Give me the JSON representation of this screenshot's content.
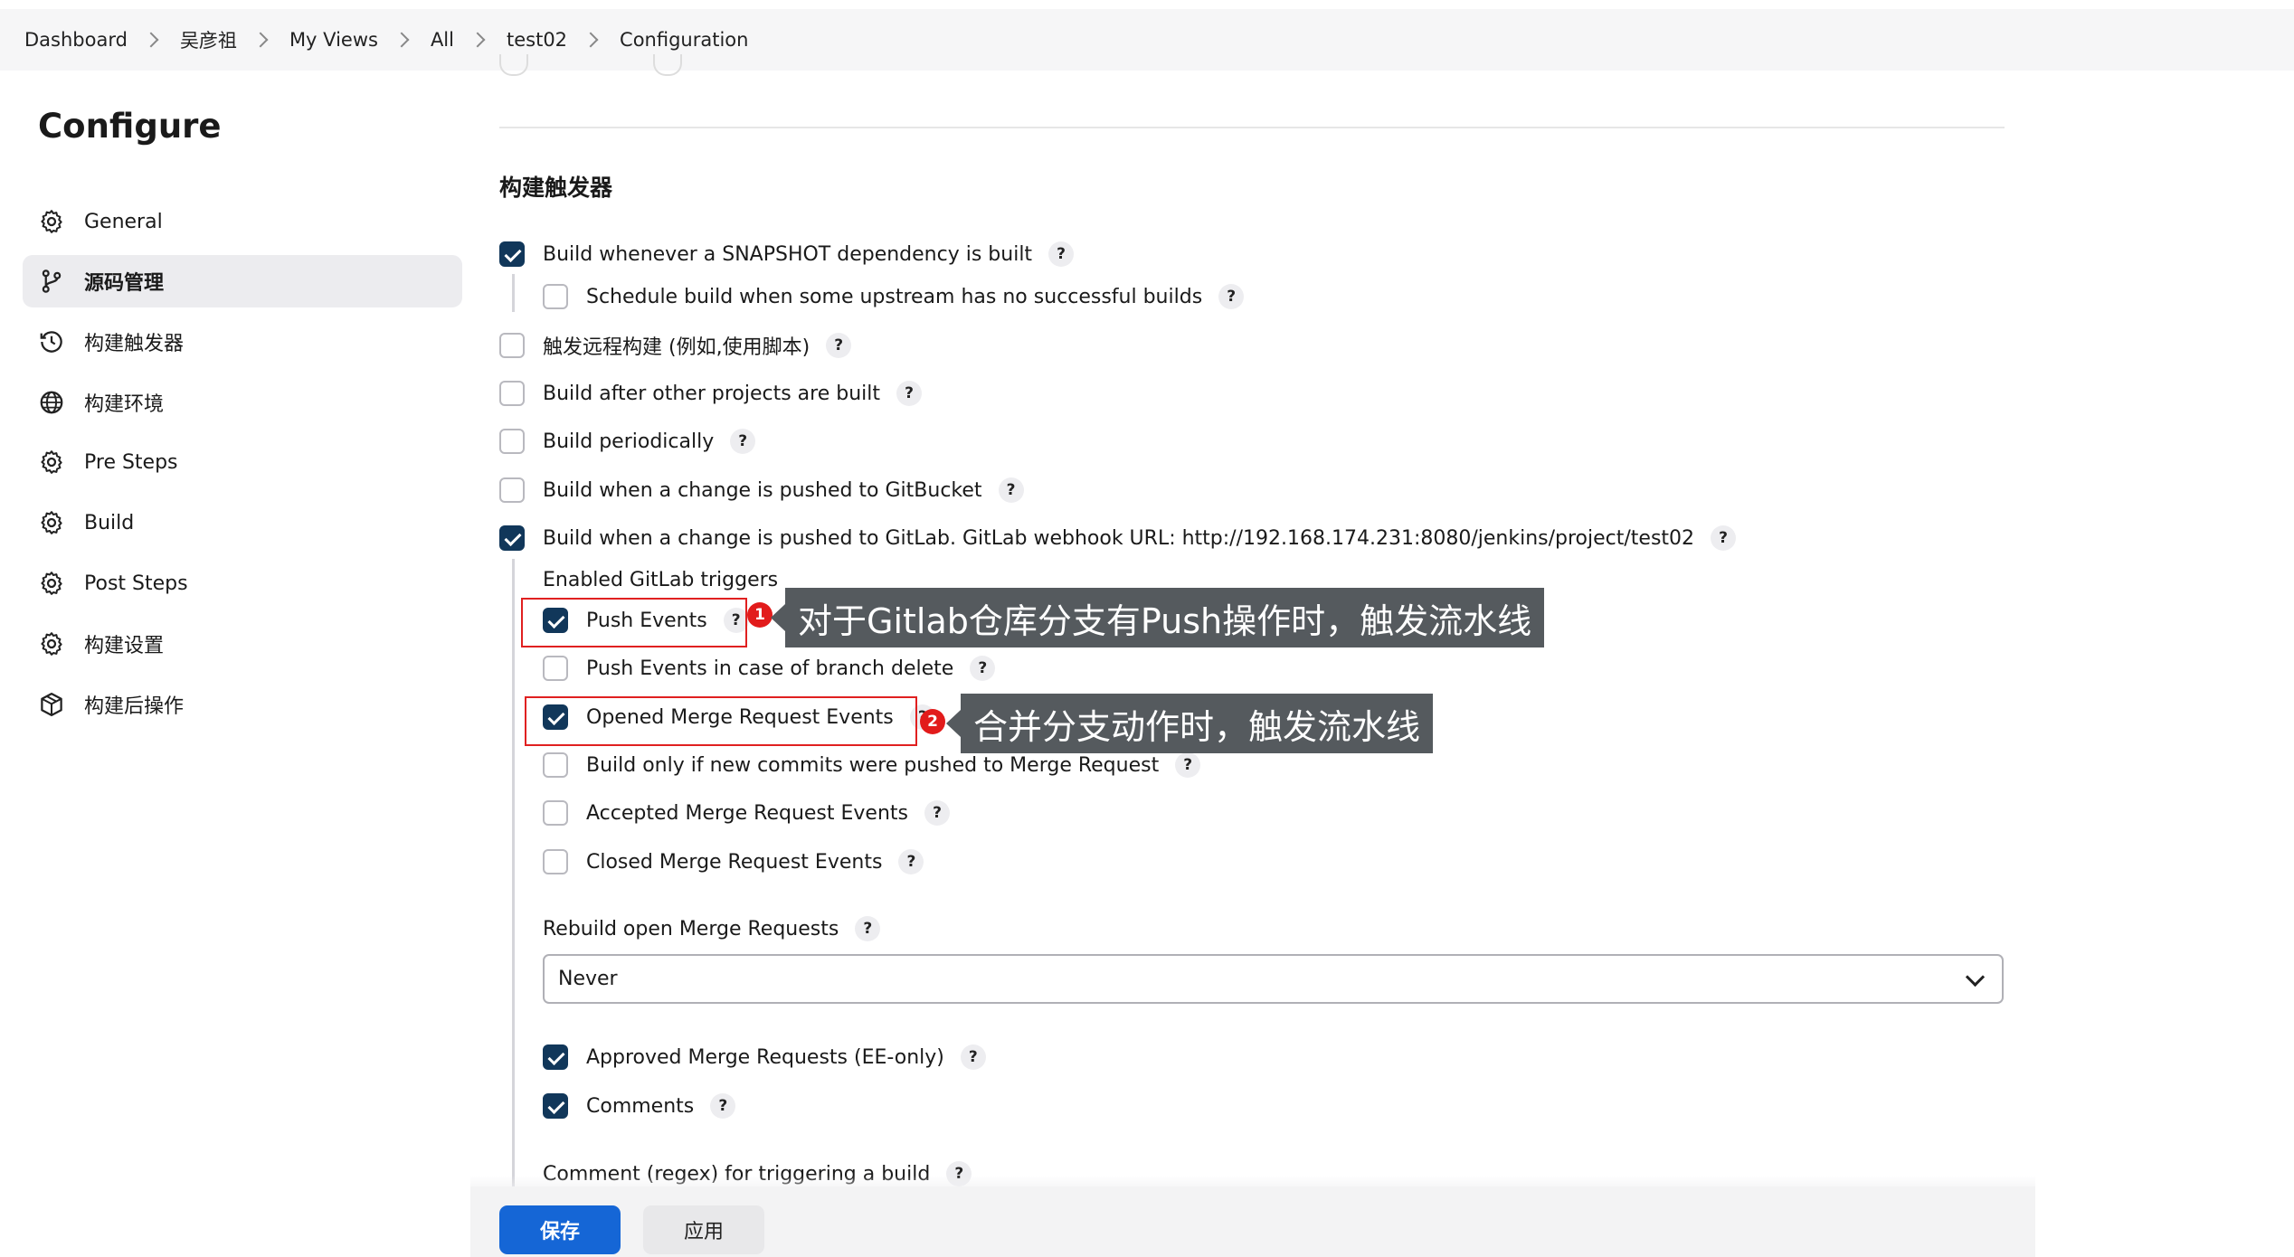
{
  "breadcrumb": [
    "Dashboard",
    "吴彦祖",
    "My Views",
    "All",
    "test02",
    "Configuration"
  ],
  "page_title": "Configure",
  "sidebar": {
    "items": [
      {
        "label": "General",
        "icon": "gear-icon"
      },
      {
        "label": "源码管理",
        "icon": "branch-icon",
        "active": true
      },
      {
        "label": "构建触发器",
        "icon": "clock-icon"
      },
      {
        "label": "构建环境",
        "icon": "globe-icon"
      },
      {
        "label": "Pre Steps",
        "icon": "gear-icon"
      },
      {
        "label": "Build",
        "icon": "gear-icon"
      },
      {
        "label": "Post Steps",
        "icon": "gear-icon"
      },
      {
        "label": "构建设置",
        "icon": "gear-icon"
      },
      {
        "label": "构建后操作",
        "icon": "package-icon"
      }
    ]
  },
  "section": {
    "title": "构建触发器",
    "options": [
      {
        "label": "Build whenever a SNAPSHOT dependency is built",
        "checked": true
      },
      {
        "label": "Schedule build when some upstream has no successful builds",
        "checked": false
      },
      {
        "label": "触发远程构建 (例如,使用脚本)",
        "checked": false
      },
      {
        "label": "Build after other projects are built",
        "checked": false
      },
      {
        "label": "Build periodically",
        "checked": false
      },
      {
        "label": "Build when a change is pushed to GitBucket",
        "checked": false
      },
      {
        "label": "Build when a change is pushed to GitLab. GitLab webhook URL: http://192.168.174.231:8080/jenkins/project/test02",
        "checked": true
      }
    ]
  },
  "gitlab": {
    "enabled_triggers_label": "Enabled GitLab triggers",
    "triggers": [
      {
        "label": "Push Events",
        "checked": true
      },
      {
        "label": "Push Events in case of branch delete",
        "checked": false
      },
      {
        "label": "Opened Merge Request Events",
        "checked": true
      },
      {
        "label": "Build only if new commits were pushed to Merge Request",
        "checked": false
      },
      {
        "label": "Accepted Merge Request Events",
        "checked": false
      },
      {
        "label": "Closed Merge Request Events",
        "checked": false
      }
    ],
    "rebuild_label": "Rebuild open Merge Requests",
    "rebuild_value": "Never",
    "extra": [
      {
        "label": "Approved Merge Requests (EE-only)",
        "checked": true
      },
      {
        "label": "Comments",
        "checked": true
      }
    ],
    "comment_regex_label": "Comment (regex) for triggering a build"
  },
  "help_glyph": "?",
  "annotations": [
    {
      "badge": "1",
      "text": "对于Gitlab仓库分支有Push操作时，触发流水线"
    },
    {
      "badge": "2",
      "text": "合并分支动作时，触发流水线"
    }
  ],
  "buttons": {
    "save": "保存",
    "apply": "应用"
  },
  "colors": {
    "accent": "#1566d6",
    "checkbox": "#11375a",
    "highlight": "#e02020",
    "callout": "#555a5e"
  }
}
